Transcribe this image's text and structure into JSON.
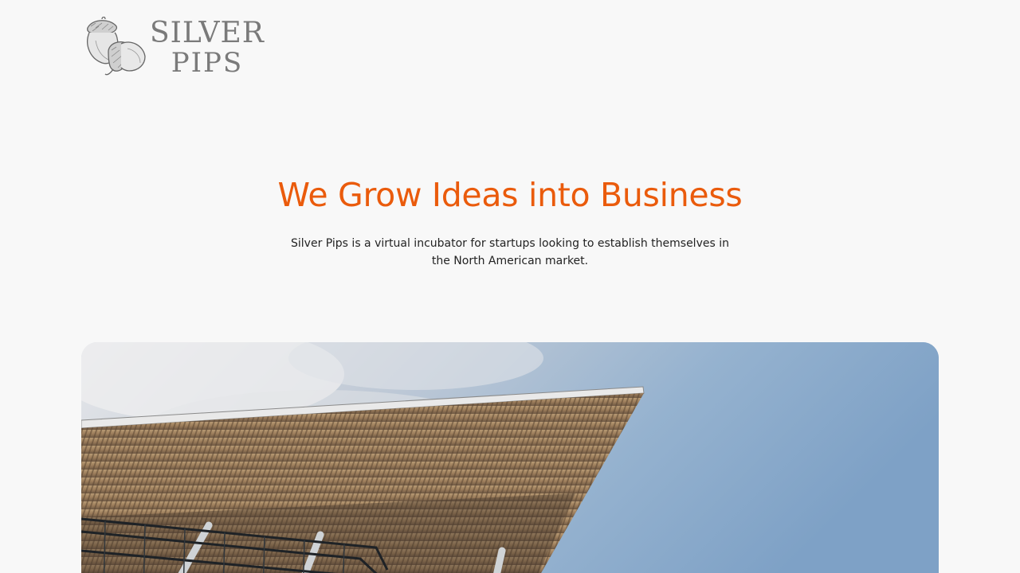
{
  "brand": {
    "name_line1": "SILVER",
    "name_line2": "PIPS",
    "icon": "acorn-icon"
  },
  "hero": {
    "title": "We Grow Ideas into Business",
    "description": "Silver Pips is a virtual incubator for startups looking to establish themselves in the North American market."
  },
  "colors": {
    "accent": "#ea5b0c",
    "background": "#f8f8f8",
    "text": "#222222",
    "logo": "#7a7a7a"
  }
}
